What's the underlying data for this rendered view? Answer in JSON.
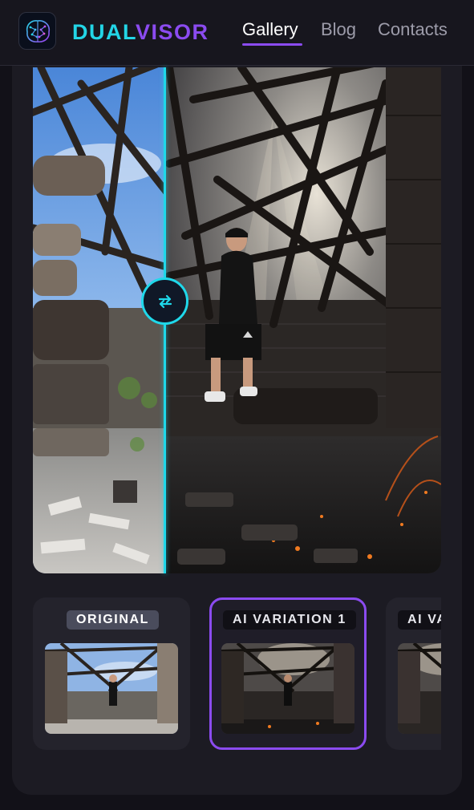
{
  "header": {
    "brand_part1": "DUAL",
    "brand_part2": "VISOR",
    "nav": [
      {
        "label": "Gallery",
        "active": true
      },
      {
        "label": "Blog",
        "active": false
      },
      {
        "label": "Contacts",
        "active": false
      }
    ],
    "colors": {
      "cyan": "#23d5e6",
      "purple": "#8b4bf0"
    }
  },
  "viewer": {
    "handle_icon": "swap-arrows-icon",
    "divider_color": "#1fd8ea",
    "split_position_fraction": 0.32
  },
  "thumbnails": [
    {
      "label": "ORIGINAL",
      "selected": false
    },
    {
      "label": "AI VARIATION 1",
      "selected": true
    },
    {
      "label": "AI VA",
      "selected": false
    }
  ]
}
